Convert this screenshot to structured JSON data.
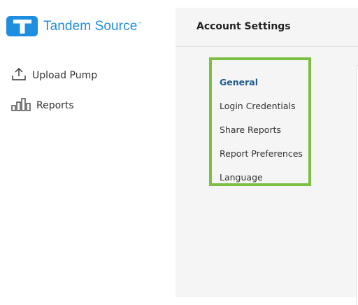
{
  "brand": {
    "name": "Tandem Source",
    "trademark": "™",
    "color": "#1d8ee0"
  },
  "sidebar": {
    "items": [
      {
        "label": "Upload Pump",
        "icon": "upload-icon"
      },
      {
        "label": "Reports",
        "icon": "bar-chart-icon"
      }
    ]
  },
  "header": {
    "title": "Account Settings"
  },
  "settings_menu": {
    "highlight_color": "#7ac043",
    "items": [
      {
        "label": "General",
        "active": true
      },
      {
        "label": "Login Credentials",
        "active": false
      },
      {
        "label": "Share Reports",
        "active": false
      },
      {
        "label": "Report Preferences",
        "active": false
      },
      {
        "label": "Language",
        "active": false
      }
    ]
  }
}
